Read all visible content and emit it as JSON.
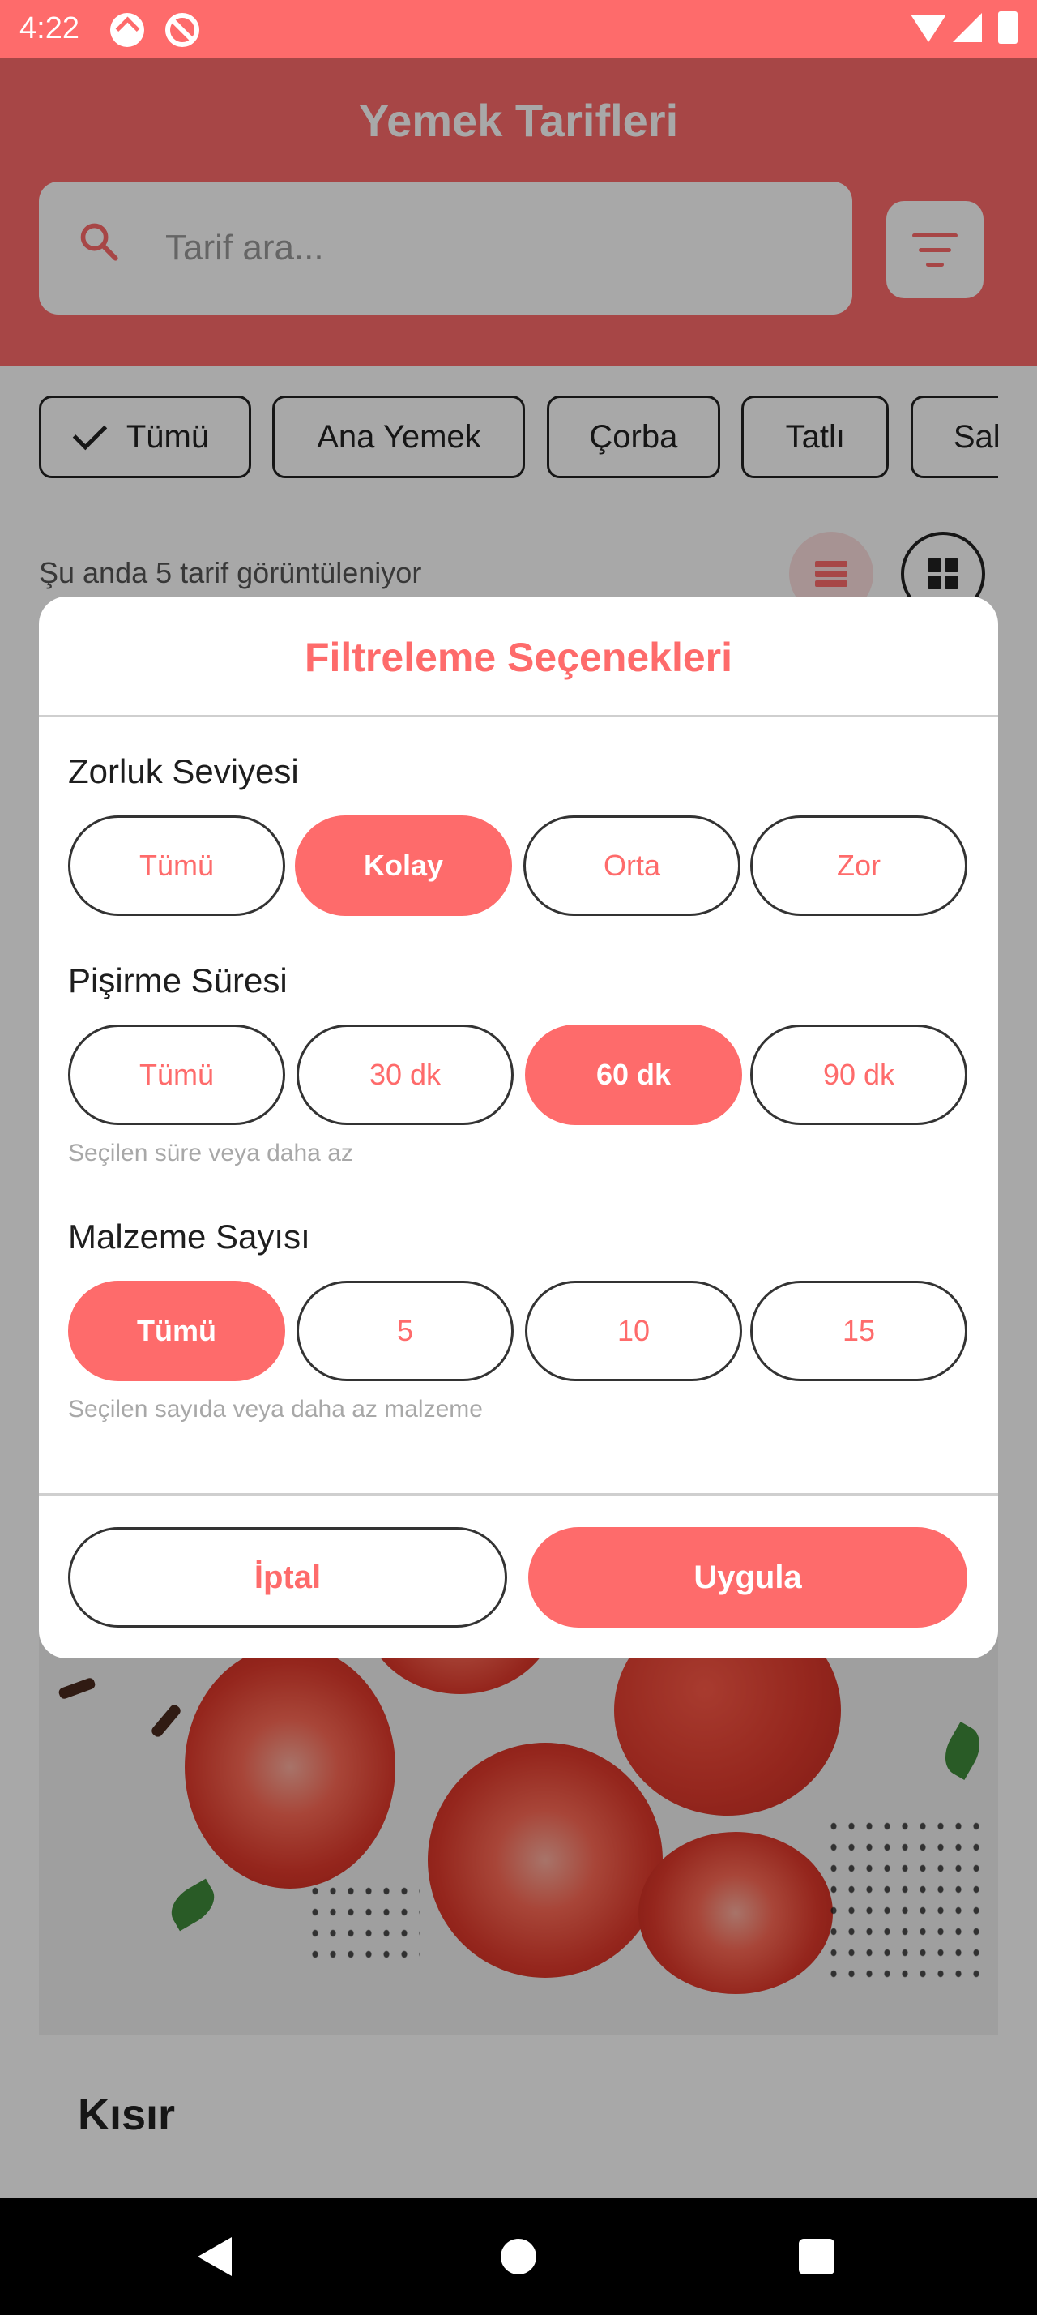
{
  "status_bar": {
    "time": "4:22"
  },
  "app": {
    "title": "Yemek Tarifleri",
    "search_placeholder": "Tarif ara...",
    "accent_color": "#fe6b6b"
  },
  "categories": [
    "Tümü",
    "Ana Yemek",
    "Çorba",
    "Tatlı",
    "Salata"
  ],
  "results_text": "Şu anda 5 tarif görüntüleniyor",
  "card": {
    "title": "Kısır"
  },
  "filter_dialog": {
    "title": "Filtreleme Seçenekleri",
    "difficulty": {
      "label": "Zorluk Seviyesi",
      "options": [
        "Tümü",
        "Kolay",
        "Orta",
        "Zor"
      ],
      "selected": "Kolay"
    },
    "cooking_time": {
      "label": "Pişirme Süresi",
      "options": [
        "Tümü",
        "30 dk",
        "60 dk",
        "90 dk"
      ],
      "selected": "60 dk",
      "helper": "Seçilen süre veya daha az"
    },
    "ingredient_count": {
      "label": "Malzeme Sayısı",
      "options": [
        "Tümü",
        "5",
        "10",
        "15"
      ],
      "selected": "Tümü",
      "helper": "Seçilen sayıda veya daha az malzeme"
    },
    "cancel_label": "İptal",
    "apply_label": "Uygula"
  }
}
